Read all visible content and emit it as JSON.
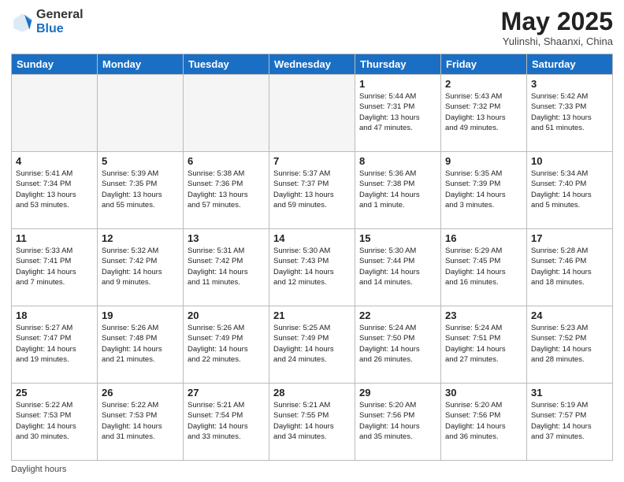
{
  "header": {
    "logo_line1": "General",
    "logo_line2": "Blue",
    "month": "May 2025",
    "location": "Yulinshi, Shaanxi, China"
  },
  "days_of_week": [
    "Sunday",
    "Monday",
    "Tuesday",
    "Wednesday",
    "Thursday",
    "Friday",
    "Saturday"
  ],
  "weeks": [
    [
      {
        "day": "",
        "info": ""
      },
      {
        "day": "",
        "info": ""
      },
      {
        "day": "",
        "info": ""
      },
      {
        "day": "",
        "info": ""
      },
      {
        "day": "1",
        "info": "Sunrise: 5:44 AM\nSunset: 7:31 PM\nDaylight: 13 hours\nand 47 minutes."
      },
      {
        "day": "2",
        "info": "Sunrise: 5:43 AM\nSunset: 7:32 PM\nDaylight: 13 hours\nand 49 minutes."
      },
      {
        "day": "3",
        "info": "Sunrise: 5:42 AM\nSunset: 7:33 PM\nDaylight: 13 hours\nand 51 minutes."
      }
    ],
    [
      {
        "day": "4",
        "info": "Sunrise: 5:41 AM\nSunset: 7:34 PM\nDaylight: 13 hours\nand 53 minutes."
      },
      {
        "day": "5",
        "info": "Sunrise: 5:39 AM\nSunset: 7:35 PM\nDaylight: 13 hours\nand 55 minutes."
      },
      {
        "day": "6",
        "info": "Sunrise: 5:38 AM\nSunset: 7:36 PM\nDaylight: 13 hours\nand 57 minutes."
      },
      {
        "day": "7",
        "info": "Sunrise: 5:37 AM\nSunset: 7:37 PM\nDaylight: 13 hours\nand 59 minutes."
      },
      {
        "day": "8",
        "info": "Sunrise: 5:36 AM\nSunset: 7:38 PM\nDaylight: 14 hours\nand 1 minute."
      },
      {
        "day": "9",
        "info": "Sunrise: 5:35 AM\nSunset: 7:39 PM\nDaylight: 14 hours\nand 3 minutes."
      },
      {
        "day": "10",
        "info": "Sunrise: 5:34 AM\nSunset: 7:40 PM\nDaylight: 14 hours\nand 5 minutes."
      }
    ],
    [
      {
        "day": "11",
        "info": "Sunrise: 5:33 AM\nSunset: 7:41 PM\nDaylight: 14 hours\nand 7 minutes."
      },
      {
        "day": "12",
        "info": "Sunrise: 5:32 AM\nSunset: 7:42 PM\nDaylight: 14 hours\nand 9 minutes."
      },
      {
        "day": "13",
        "info": "Sunrise: 5:31 AM\nSunset: 7:42 PM\nDaylight: 14 hours\nand 11 minutes."
      },
      {
        "day": "14",
        "info": "Sunrise: 5:30 AM\nSunset: 7:43 PM\nDaylight: 14 hours\nand 12 minutes."
      },
      {
        "day": "15",
        "info": "Sunrise: 5:30 AM\nSunset: 7:44 PM\nDaylight: 14 hours\nand 14 minutes."
      },
      {
        "day": "16",
        "info": "Sunrise: 5:29 AM\nSunset: 7:45 PM\nDaylight: 14 hours\nand 16 minutes."
      },
      {
        "day": "17",
        "info": "Sunrise: 5:28 AM\nSunset: 7:46 PM\nDaylight: 14 hours\nand 18 minutes."
      }
    ],
    [
      {
        "day": "18",
        "info": "Sunrise: 5:27 AM\nSunset: 7:47 PM\nDaylight: 14 hours\nand 19 minutes."
      },
      {
        "day": "19",
        "info": "Sunrise: 5:26 AM\nSunset: 7:48 PM\nDaylight: 14 hours\nand 21 minutes."
      },
      {
        "day": "20",
        "info": "Sunrise: 5:26 AM\nSunset: 7:49 PM\nDaylight: 14 hours\nand 22 minutes."
      },
      {
        "day": "21",
        "info": "Sunrise: 5:25 AM\nSunset: 7:49 PM\nDaylight: 14 hours\nand 24 minutes."
      },
      {
        "day": "22",
        "info": "Sunrise: 5:24 AM\nSunset: 7:50 PM\nDaylight: 14 hours\nand 26 minutes."
      },
      {
        "day": "23",
        "info": "Sunrise: 5:24 AM\nSunset: 7:51 PM\nDaylight: 14 hours\nand 27 minutes."
      },
      {
        "day": "24",
        "info": "Sunrise: 5:23 AM\nSunset: 7:52 PM\nDaylight: 14 hours\nand 28 minutes."
      }
    ],
    [
      {
        "day": "25",
        "info": "Sunrise: 5:22 AM\nSunset: 7:53 PM\nDaylight: 14 hours\nand 30 minutes."
      },
      {
        "day": "26",
        "info": "Sunrise: 5:22 AM\nSunset: 7:53 PM\nDaylight: 14 hours\nand 31 minutes."
      },
      {
        "day": "27",
        "info": "Sunrise: 5:21 AM\nSunset: 7:54 PM\nDaylight: 14 hours\nand 33 minutes."
      },
      {
        "day": "28",
        "info": "Sunrise: 5:21 AM\nSunset: 7:55 PM\nDaylight: 14 hours\nand 34 minutes."
      },
      {
        "day": "29",
        "info": "Sunrise: 5:20 AM\nSunset: 7:56 PM\nDaylight: 14 hours\nand 35 minutes."
      },
      {
        "day": "30",
        "info": "Sunrise: 5:20 AM\nSunset: 7:56 PM\nDaylight: 14 hours\nand 36 minutes."
      },
      {
        "day": "31",
        "info": "Sunrise: 5:19 AM\nSunset: 7:57 PM\nDaylight: 14 hours\nand 37 minutes."
      }
    ]
  ],
  "footer": {
    "label": "Daylight hours"
  }
}
